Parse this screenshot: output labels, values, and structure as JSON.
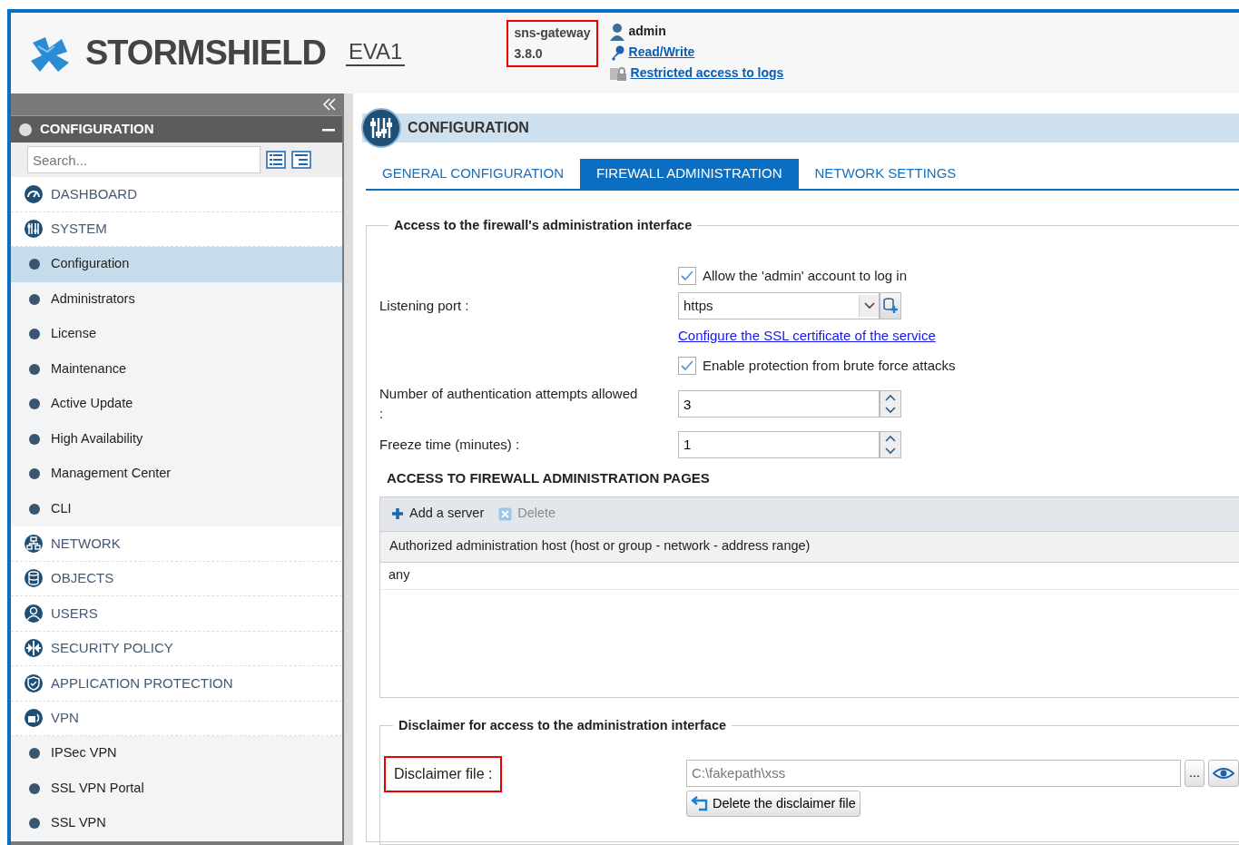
{
  "header": {
    "brand": "STORMSHIELD",
    "model": "EVA1",
    "device": {
      "name": "sns-gateway",
      "version": "3.8.0",
      "highlighted": true
    },
    "user": {
      "name": "admin",
      "rights": "Read/Write",
      "logs": "Restricted access to logs"
    }
  },
  "sidebar": {
    "title": "CONFIGURATION",
    "search": {
      "placeholder": "Search..."
    },
    "items": [
      {
        "kind": "module",
        "label": "DASHBOARD",
        "selected": false
      },
      {
        "kind": "module",
        "label": "SYSTEM",
        "selected": false
      },
      {
        "kind": "sub",
        "label": "Configuration",
        "selected": true
      },
      {
        "kind": "sub",
        "label": "Administrators",
        "selected": false
      },
      {
        "kind": "sub",
        "label": "License",
        "selected": false
      },
      {
        "kind": "sub",
        "label": "Maintenance",
        "selected": false
      },
      {
        "kind": "sub",
        "label": "Active Update",
        "selected": false
      },
      {
        "kind": "sub",
        "label": "High Availability",
        "selected": false
      },
      {
        "kind": "sub",
        "label": "Management Center",
        "selected": false
      },
      {
        "kind": "sub",
        "label": "CLI",
        "selected": false
      },
      {
        "kind": "module",
        "label": "NETWORK",
        "selected": false
      },
      {
        "kind": "module",
        "label": "OBJECTS",
        "selected": false
      },
      {
        "kind": "module",
        "label": "USERS",
        "selected": false
      },
      {
        "kind": "module",
        "label": "SECURITY POLICY",
        "selected": false
      },
      {
        "kind": "module",
        "label": "APPLICATION PROTECTION",
        "selected": false
      },
      {
        "kind": "module",
        "label": "VPN",
        "selected": false
      },
      {
        "kind": "sub",
        "label": "IPSec VPN",
        "selected": false
      },
      {
        "kind": "sub",
        "label": "SSL VPN Portal",
        "selected": false
      },
      {
        "kind": "sub",
        "label": "SSL VPN",
        "selected": false
      }
    ]
  },
  "page": {
    "title": "CONFIGURATION",
    "tabs": [
      {
        "label": "GENERAL CONFIGURATION",
        "selected": false
      },
      {
        "label": "FIREWALL ADMINISTRATION",
        "selected": true
      },
      {
        "label": "NETWORK SETTINGS",
        "selected": false
      }
    ],
    "access": {
      "legend": "Access to the firewall's administration interface",
      "allow_admin": {
        "label": "Allow the 'admin' account to log in",
        "checked": true
      },
      "listening_port": {
        "label": "Listening port :",
        "value": "https"
      },
      "ssl_link": "Configure the SSL certificate of the service",
      "brute_force": {
        "label": "Enable protection from brute force attacks",
        "checked": true
      },
      "attempts": {
        "label": "Number of authentication attempts allowed :",
        "value": "3"
      },
      "freeze": {
        "label": "Freeze time (minutes) :",
        "value": "1"
      }
    },
    "pages": {
      "heading": "ACCESS TO FIREWALL ADMINISTRATION PAGES",
      "toolbar": [
        {
          "kind": "add",
          "label": "Add a server",
          "disabled": false
        },
        {
          "kind": "delete",
          "label": "Delete",
          "disabled": true
        }
      ],
      "table": {
        "columns": [
          "Authorized administration host (host or group - network - address range)"
        ],
        "rows": [
          [
            "any"
          ]
        ]
      }
    },
    "disclaimer": {
      "legend": "Disclaimer for access to the administration interface",
      "label": "Disclaimer file :",
      "highlighted": true,
      "value": "C:\\fakepath\\xss",
      "browse": "...",
      "delete": "Delete the disclaimer file"
    }
  }
}
